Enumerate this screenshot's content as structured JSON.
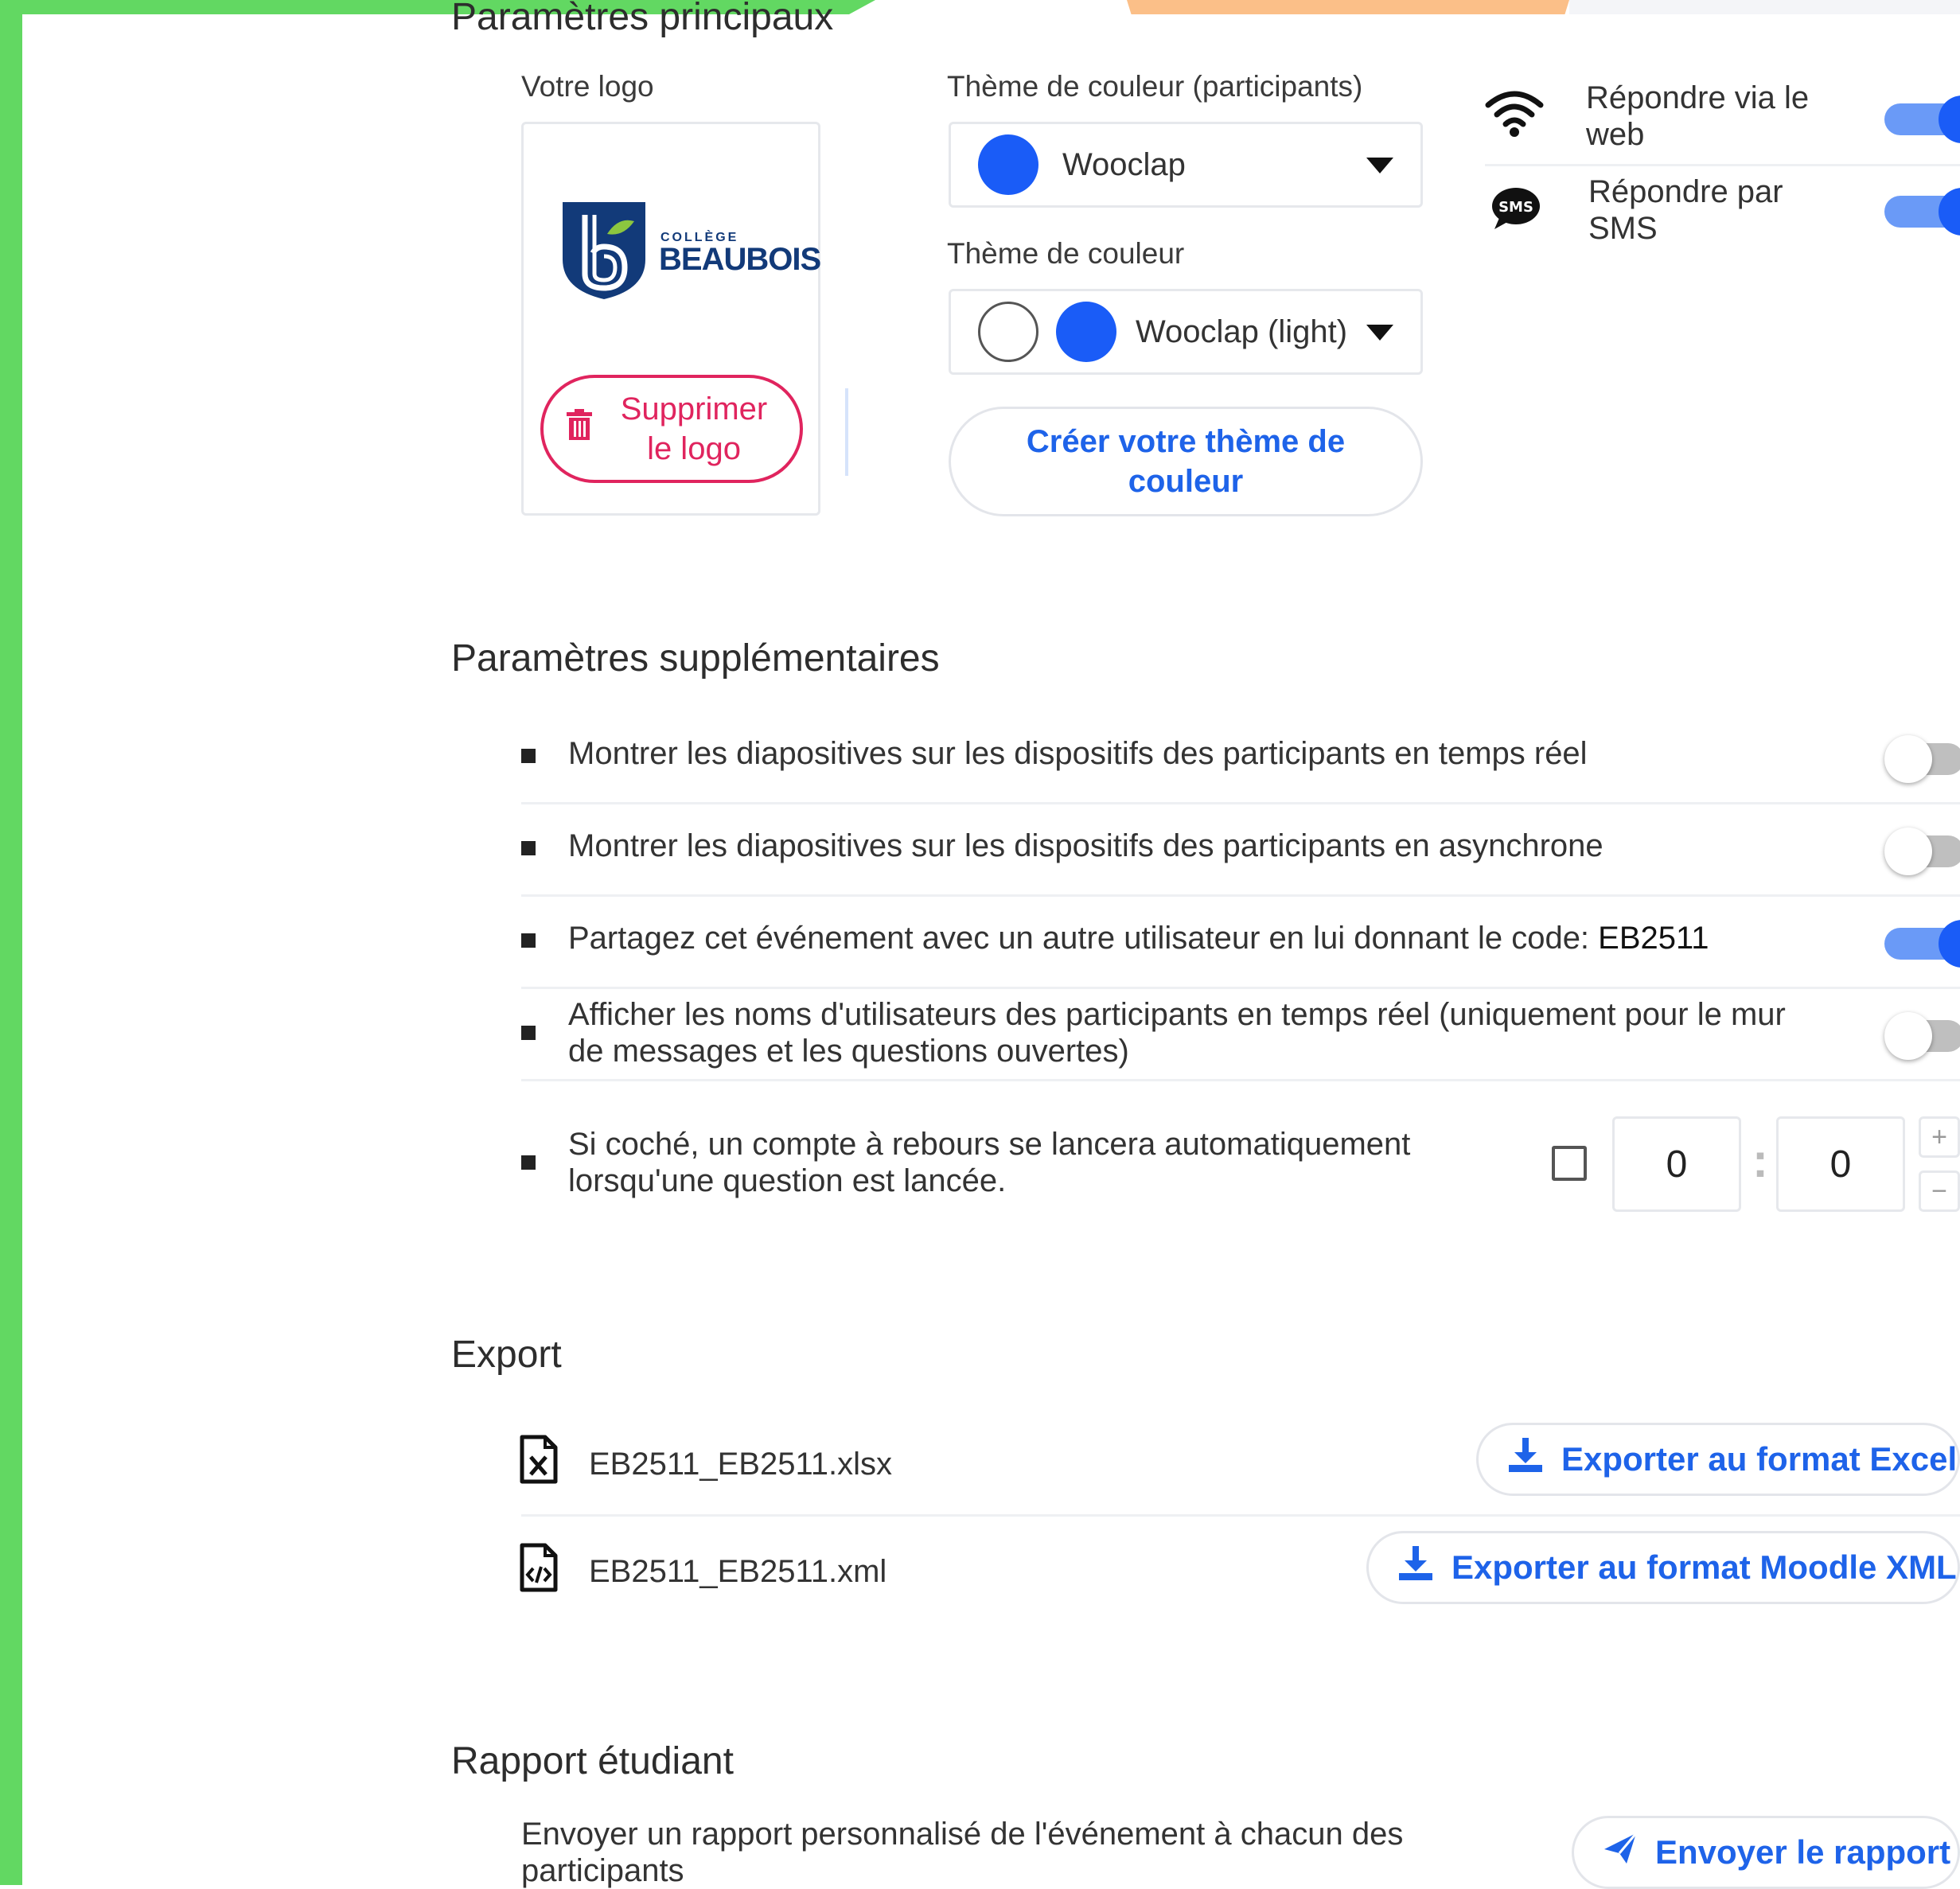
{
  "colors": {
    "accent": "#1a5cf7",
    "link": "#1e63e9",
    "danger": "#e0245e",
    "frame_green": "#62d862",
    "frame_orange": "#fbbf88"
  },
  "main_settings": {
    "title": "Paramètres principaux",
    "logo": {
      "label": "Votre logo",
      "brand_small": "COLLÈGE",
      "brand_name": "BEAUBOIS",
      "delete_line1": "Supprimer",
      "delete_line2": "le logo",
      "delete_icon": "trash-icon"
    },
    "participant_theme": {
      "label": "Thème de couleur (participants)",
      "value": "Wooclap"
    },
    "color_theme": {
      "label": "Thème de couleur",
      "value": "Wooclap (light)"
    },
    "create_theme": {
      "line1": "Créer votre thème de",
      "line2": "couleur"
    },
    "reply_web": {
      "line1": "Répondre via le",
      "line2": "web",
      "icon": "wifi-icon",
      "enabled": true
    },
    "reply_sms": {
      "line1": "Répondre par",
      "line2": "SMS",
      "icon": "sms-icon",
      "icon_text": "SMS",
      "enabled": true
    }
  },
  "extra_settings": {
    "title": "Paramètres supplémentaires",
    "items": [
      {
        "text": "Montrer les diapositives sur les dispositifs des participants en temps réel",
        "enabled": false
      },
      {
        "text": "Montrer les diapositives sur les dispositifs des participants en asynchrone",
        "enabled": false
      },
      {
        "text": "Partagez cet événement avec un autre utilisateur en lui donnant le code: ",
        "code": "EB2511",
        "enabled": true
      },
      {
        "line1": "Afficher les noms d'utilisateurs des participants en temps réel (uniquement pour le mur",
        "line2": "de messages et les questions ouvertes)",
        "enabled": false
      }
    ],
    "countdown": {
      "line1": "Si coché, un compte à rebours se lancera automatiquement",
      "line2": "lorsqu'une question est lancée.",
      "checked": false,
      "minutes": "0",
      "seconds": "0",
      "separator": ":",
      "plus": "+",
      "minus": "−"
    }
  },
  "export": {
    "title": "Export",
    "files": [
      {
        "name": "EB2511_EB2511.xlsx",
        "icon": "excel-file-icon",
        "button": "Exporter au format Excel",
        "button_icon": "download-icon"
      },
      {
        "name": "EB2511_EB2511.xml",
        "icon": "xml-file-icon",
        "button": "Exporter au format Moodle XML",
        "button_icon": "download-icon"
      }
    ]
  },
  "report": {
    "title": "Rapport étudiant",
    "line1": "Envoyer un rapport personnalisé de l'événement à chacun des",
    "line2": "participants",
    "button": "Envoyer le rapport",
    "button_icon": "send-icon"
  }
}
